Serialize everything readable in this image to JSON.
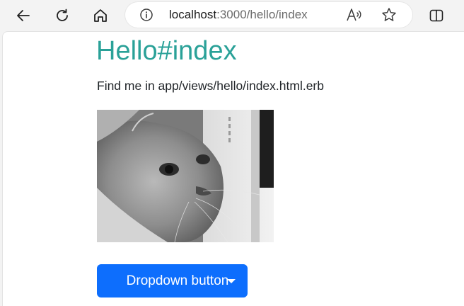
{
  "browser": {
    "url_host": "localhost",
    "url_path": ":3000/hello/index",
    "icons": {
      "back": "arrow-left-icon",
      "refresh": "refresh-icon",
      "home": "home-icon",
      "info": "info-icon",
      "read_aloud": "read-aloud-icon",
      "favorite": "star-icon",
      "split_screen": "split-screen-icon"
    }
  },
  "page": {
    "heading": "Hello#index",
    "paragraph": "Find me in app/views/hello/index.html.erb",
    "image_subject": "grayscale cat photo",
    "dropdown_label": "Dropdown button",
    "colors": {
      "heading": "#2aa198",
      "button": "#0d6efd"
    }
  }
}
